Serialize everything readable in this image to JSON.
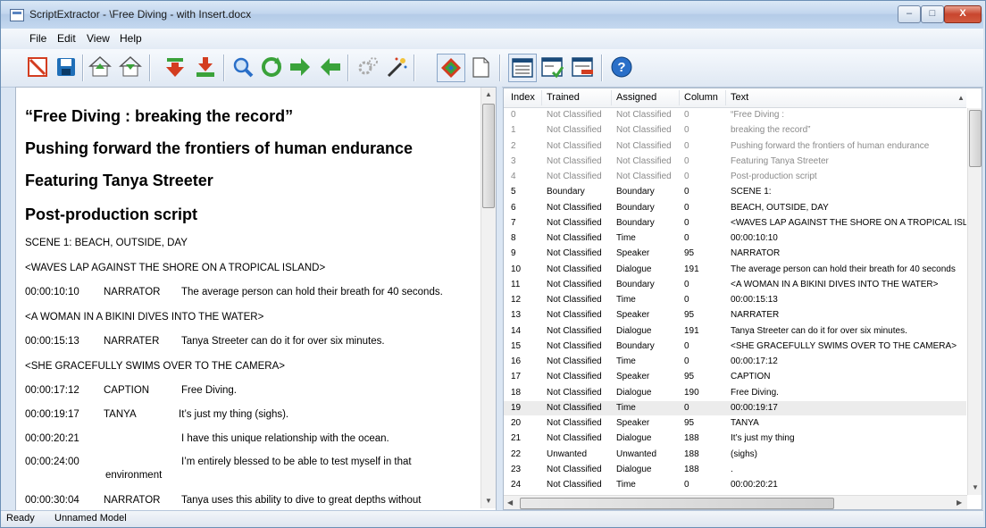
{
  "window": {
    "title": "ScriptExtractor - \\Free Diving - with Insert.docx",
    "minimize": "–",
    "maximize": "□",
    "close": "X"
  },
  "menu": [
    "File",
    "Edit",
    "View",
    "Help"
  ],
  "toolbar": {
    "buttons": [
      "new-icon",
      "save-icon",
      "house-up-icon",
      "house-down-icon",
      "arrow-down-red-icon",
      "arrow-down-save-icon",
      "magnify-icon",
      "refresh-icon",
      "arrow-right-icon",
      "arrow-left-icon",
      "gears-icon",
      "magic-wand-icon",
      "diamond-icon",
      "page-icon",
      "list-view-icon",
      "list-check-icon",
      "list-remove-icon",
      "help-icon"
    ],
    "colors": {
      "green": "#3aa23a",
      "red": "#d33d20",
      "blue": "#2a6fc8",
      "navy": "#1a4a7a"
    }
  },
  "document": {
    "headings": [
      "“Free Diving : breaking the record”",
      "Pushing forward the frontiers of human endurance",
      "Featuring Tanya Streeter",
      "Post-production script"
    ],
    "lines": [
      {
        "text": "SCENE 1: BEACH, OUTSIDE, DAY"
      },
      {
        "text": "<WAVES LAP AGAINST THE SHORE ON A TROPICAL ISLAND>"
      },
      {
        "tc": "00:00:10:10",
        "sp": "NARRATOR",
        "tx": "The average person can hold their breath for 40 seconds."
      },
      {
        "text": "<A WOMAN IN A BIKINI DIVES INTO THE WATER>"
      },
      {
        "tc": "00:00:15:13",
        "sp": "NARRATER",
        "tx": "Tanya Streeter can do it for over six minutes."
      },
      {
        "text": "<SHE GRACEFULLY SWIMS OVER TO THE CAMERA>"
      },
      {
        "tc": "00:00:17:12",
        "sp": "CAPTION",
        "tx": "Free Diving."
      },
      {
        "tc": "00:00:19:17",
        "sp": "TANYA",
        "tx": "It’s just my thing (sighs)."
      },
      {
        "tc": "00:00:20:21",
        "sp": "",
        "tx": "I have this unique relationship with the ocean."
      },
      {
        "tc": "00:00:24:00",
        "sp": "",
        "tx": "I’m entirely blessed to be able to test myself in that",
        "cont": "environment"
      },
      {
        "tc": "00:00:30:04",
        "sp": "NARRATOR",
        "tx": "Tanya uses this ability to dive to great depths without"
      }
    ]
  },
  "table": {
    "headers": [
      "Index",
      "Trained",
      "Assigned",
      "Column",
      "Text"
    ],
    "rows": [
      [
        "0",
        "Not Classified",
        "Not Classified",
        "0",
        "“Free Diving :"
      ],
      [
        "1",
        "Not Classified",
        "Not Classified",
        "0",
        "breaking the record”"
      ],
      [
        "2",
        "Not Classified",
        "Not Classified",
        "0",
        "Pushing forward the frontiers of human endurance"
      ],
      [
        "3",
        "Not Classified",
        "Not Classified",
        "0",
        "Featuring Tanya Streeter"
      ],
      [
        "4",
        "Not Classified",
        "Not Classified",
        "0",
        "Post-production script"
      ],
      [
        "5",
        "Boundary",
        "Boundary",
        "0",
        "SCENE 1:"
      ],
      [
        "6",
        "Not Classified",
        "Boundary",
        "0",
        "BEACH, OUTSIDE, DAY"
      ],
      [
        "7",
        "Not Classified",
        "Boundary",
        "0",
        "<WAVES LAP AGAINST THE SHORE ON A TROPICAL ISL"
      ],
      [
        "8",
        "Not Classified",
        "Time",
        "0",
        "00:00:10:10"
      ],
      [
        "9",
        "Not Classified",
        "Speaker",
        "95",
        "NARRATOR"
      ],
      [
        "10",
        "Not Classified",
        "Dialogue",
        "191",
        "The average person can hold their breath for 40 seconds"
      ],
      [
        "11",
        "Not Classified",
        "Boundary",
        "0",
        "<A WOMAN IN A BIKINI DIVES INTO THE WATER>"
      ],
      [
        "12",
        "Not Classified",
        "Time",
        "0",
        "00:00:15:13"
      ],
      [
        "13",
        "Not Classified",
        "Speaker",
        "95",
        "NARRATER"
      ],
      [
        "14",
        "Not Classified",
        "Dialogue",
        "191",
        "Tanya Streeter can do it for over six minutes."
      ],
      [
        "15",
        "Not Classified",
        "Boundary",
        "0",
        "<SHE GRACEFULLY SWIMS OVER TO THE CAMERA>"
      ],
      [
        "16",
        "Not Classified",
        "Time",
        "0",
        "00:00:17:12"
      ],
      [
        "17",
        "Not Classified",
        "Speaker",
        "95",
        "CAPTION"
      ],
      [
        "18",
        "Not Classified",
        "Dialogue",
        "190",
        "Free Diving."
      ],
      [
        "19",
        "Not Classified",
        "Time",
        "0",
        "00:00:19:17"
      ],
      [
        "20",
        "Not Classified",
        "Speaker",
        "95",
        "TANYA"
      ],
      [
        "21",
        "Not Classified",
        "Dialogue",
        "188",
        "It’s just my thing"
      ],
      [
        "22",
        "Unwanted",
        "Unwanted",
        "188",
        "(sighs)"
      ],
      [
        "23",
        "Not Classified",
        "Dialogue",
        "188",
        "."
      ],
      [
        "24",
        "Not Classified",
        "Time",
        "0",
        "00:00:20:21"
      ]
    ]
  },
  "status": {
    "text": "Ready",
    "model": "Unnamed Model"
  }
}
